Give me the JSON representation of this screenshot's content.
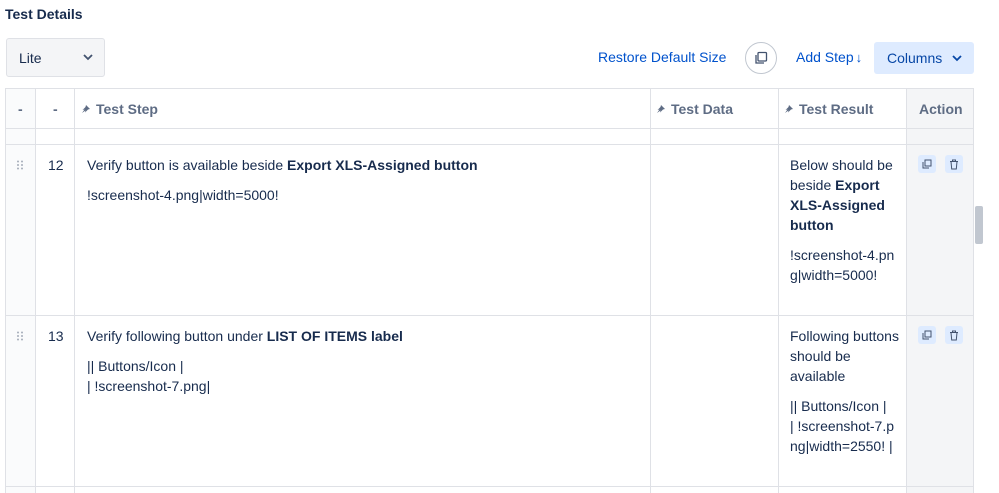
{
  "section_title": "Test Details",
  "view_select": {
    "value": "Lite"
  },
  "toolbar": {
    "restore_label": "Restore Default Size",
    "add_step_label": "Add Step",
    "add_step_arrow": "↓",
    "columns_label": "Columns"
  },
  "columns": {
    "c1": "-",
    "c2": "-",
    "test_step": "Test Step",
    "test_data": "Test Data",
    "test_result": "Test Result",
    "action": "Action"
  },
  "rows": [
    {
      "num": "12",
      "step_pre": "Verify button is available beside ",
      "step_bold": "Export XLS-Assigned button",
      "step_line2": "!screenshot-4.png|width=5000!",
      "result_pre": "Below should be beside ",
      "result_bold": "Export XLS-Assigned button",
      "result_line2": "!screenshot-4.png|width=5000!"
    },
    {
      "num": "13",
      "step_pre": "Verify following button under ",
      "step_bold": "LIST OF ITEMS label",
      "step_line2": "|| Buttons/Icon |",
      "step_line3": "| !screenshot-7.png|",
      "result_pre": "Following buttons should be available",
      "result_line2": "|| Buttons/Icon |",
      "result_line3": "| !screenshot-7.png|width=2550! |"
    }
  ],
  "icons": {
    "dropdown": "chevron-down-icon",
    "copy": "copy-icon",
    "pin": "pin-icon",
    "drag": "drag-handle-icon",
    "clone": "clone-icon",
    "delete": "trash-icon"
  },
  "colors": {
    "link": "#0052cc",
    "columns_bg": "#deebff",
    "header_text": "#5e6c84"
  }
}
